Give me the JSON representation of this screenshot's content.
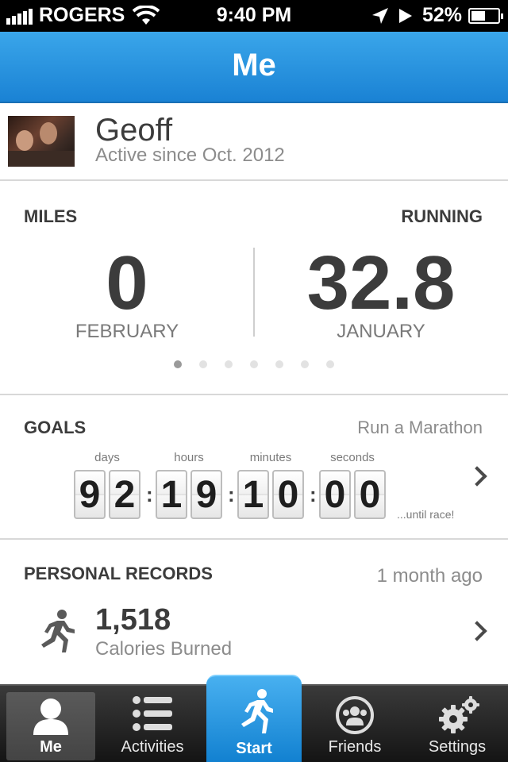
{
  "status_bar": {
    "carrier": "ROGERS",
    "time": "9:40 PM",
    "battery": "52%",
    "battery_level": 0.52,
    "signal_icon": "signal-bars-icon",
    "wifi_icon": "wifi-icon",
    "location_icon": "location-arrow-icon",
    "play_icon": "play-icon"
  },
  "nav": {
    "title": "Me"
  },
  "profile": {
    "name": "Geoff",
    "since": "Active since Oct. 2012"
  },
  "stats": {
    "left_label": "MILES",
    "right_label": "RUNNING",
    "left_value": "0",
    "left_month": "FEBRUARY",
    "right_value": "32.8",
    "right_month": "JANUARY",
    "page_count": 7,
    "active_page": 1
  },
  "goals": {
    "label": "GOALS",
    "goal_name": "Run a Marathon",
    "units": [
      "days",
      "hours",
      "minutes",
      "seconds"
    ],
    "digits": [
      "9",
      "2",
      "1",
      "9",
      "1",
      "0",
      "0",
      "0"
    ],
    "until": "...until race!"
  },
  "records": {
    "label": "PERSONAL RECORDS",
    "ago": "1 month ago",
    "value": "1,518",
    "value_label": "Calories Burned"
  },
  "tabs": [
    {
      "label": "Me",
      "icon": "person-icon"
    },
    {
      "label": "Activities",
      "icon": "list-icon"
    },
    {
      "label": "Start",
      "icon": "runner-icon"
    },
    {
      "label": "Friends",
      "icon": "friends-icon"
    },
    {
      "label": "Settings",
      "icon": "gears-icon"
    }
  ],
  "colors": {
    "nav_blue": "#1a82d4",
    "start_blue": "#1180d0",
    "text": "#3c3c3c",
    "muted": "#8c8c8c"
  }
}
